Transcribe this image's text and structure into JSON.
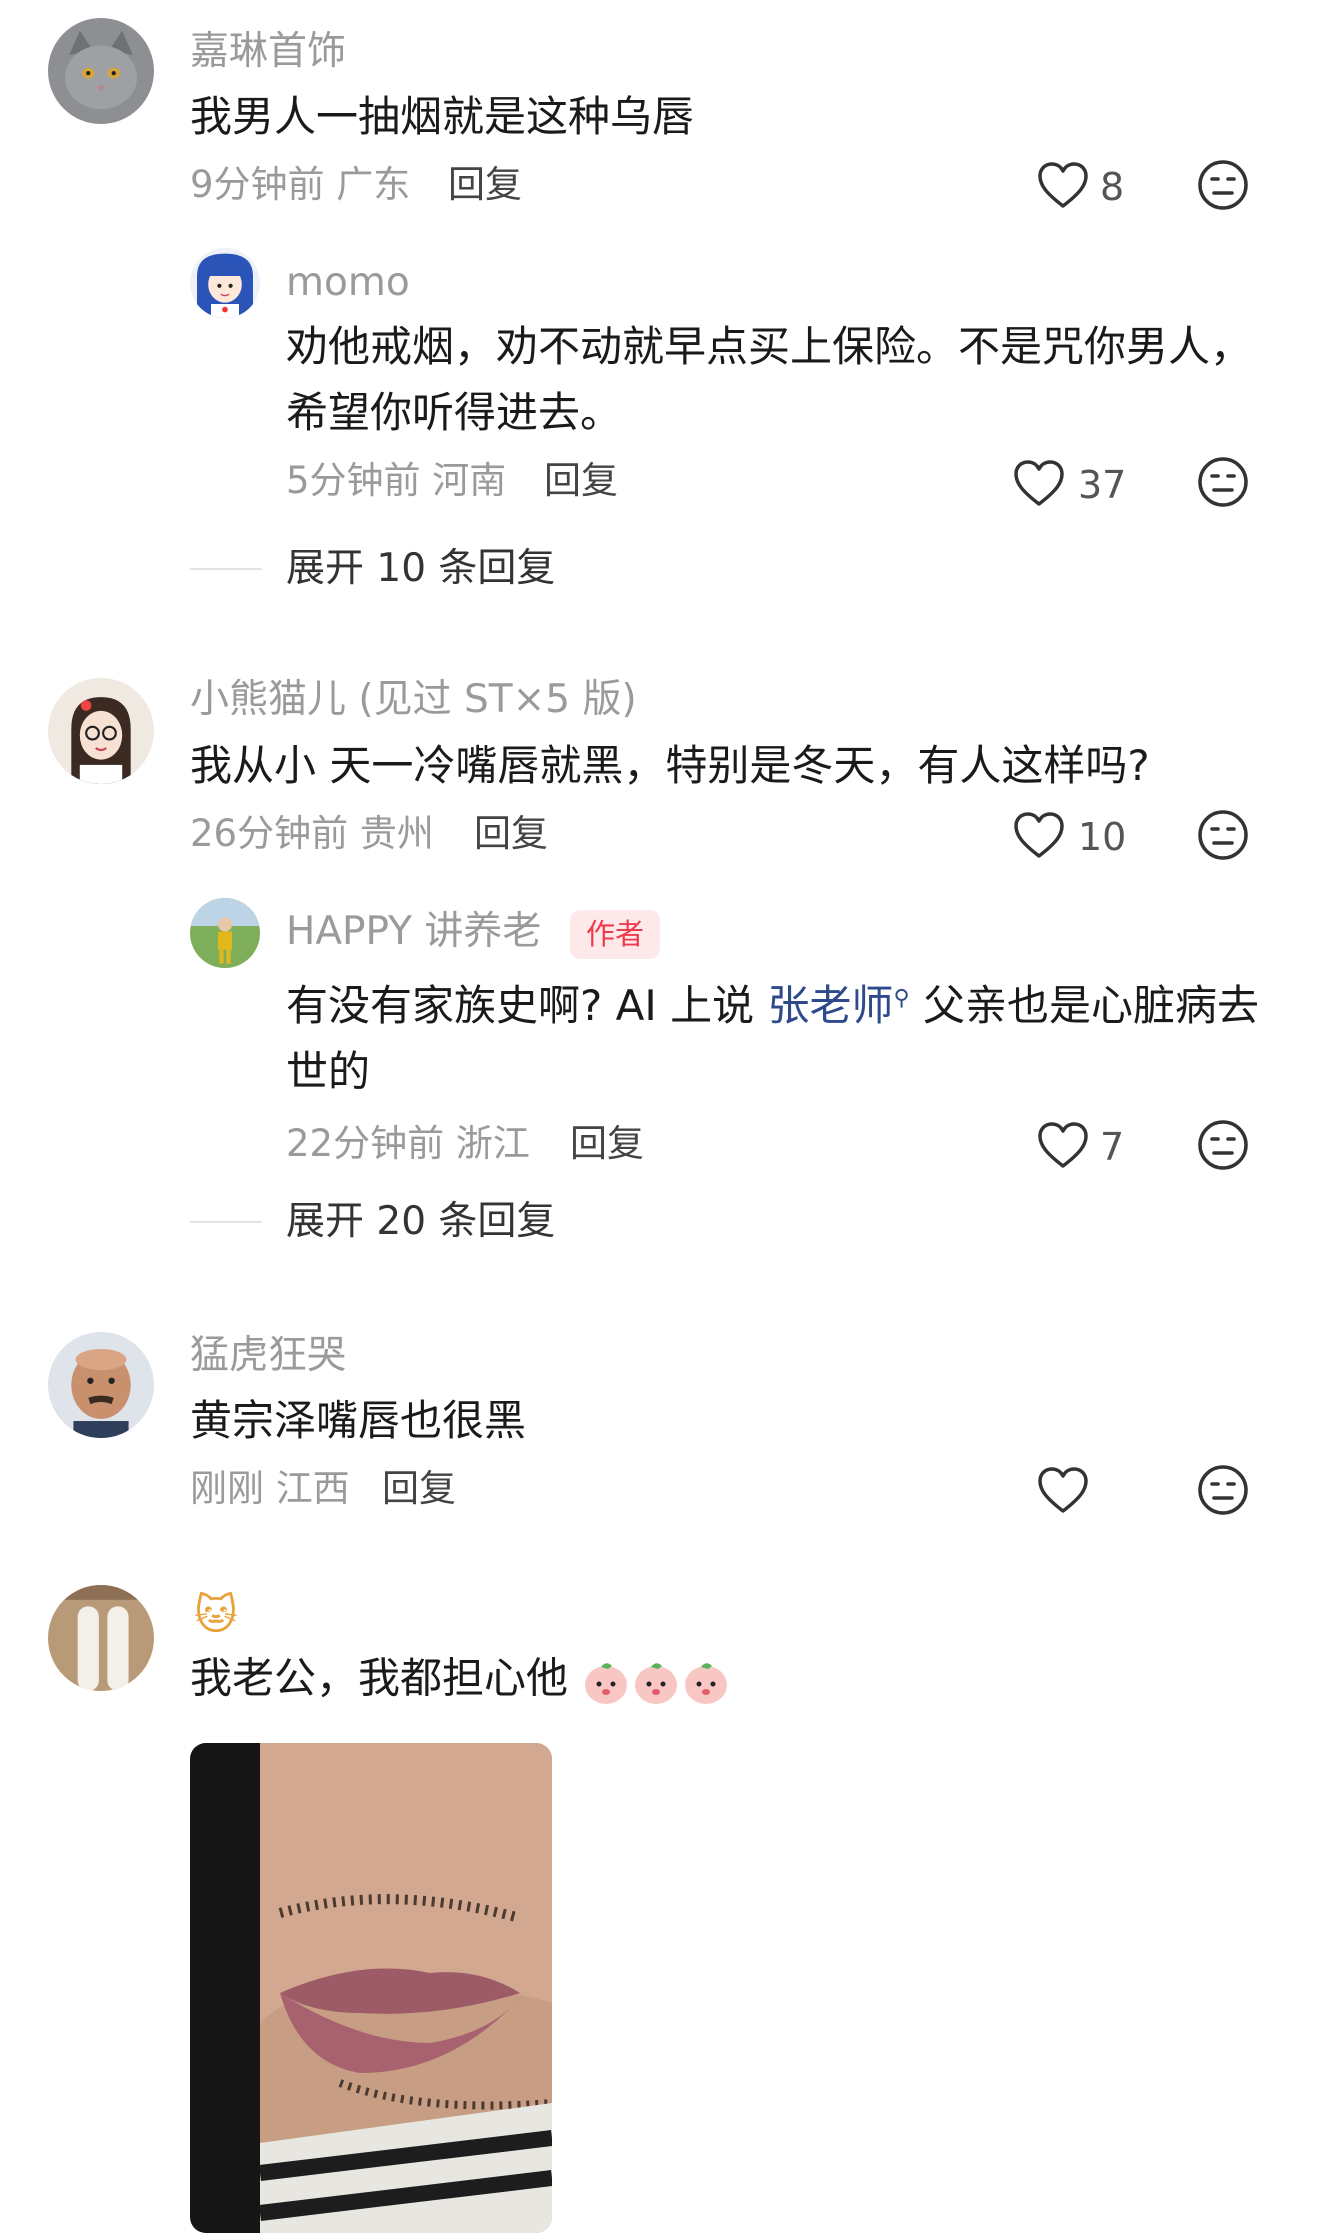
{
  "comments": [
    {
      "author": "嘉琳首饰",
      "text": "我男人一抽烟就是这种乌唇",
      "time_location": "9分钟前 广东",
      "reply_label": "回复",
      "likes": "8",
      "replies": [
        {
          "author": "momo",
          "text": "劝他戒烟，劝不动就早点买上保险。不是咒你男人，希望你听得进去。",
          "time_location": "5分钟前 河南",
          "reply_label": "回复",
          "likes": "37"
        }
      ],
      "expand_label": "展开 10 条回复"
    },
    {
      "author": "小熊猫儿 (见过 ST×5 版)",
      "text": "我从小 天一冷嘴唇就黑，特别是冬天，有人这样吗?",
      "time_location": "26分钟前 贵州",
      "reply_label": "回复",
      "likes": "10",
      "replies": [
        {
          "author": "HAPPY 讲养老",
          "badge": "作者",
          "text_before": "有没有家族史啊? AI 上说 ",
          "mention": "张老师",
          "text_after": " 父亲也是心脏病去世的",
          "time_location": "22分钟前 浙江",
          "reply_label": "回复",
          "likes": "7"
        }
      ],
      "expand_label": "展开 20 条回复"
    },
    {
      "author": "猛虎狂哭",
      "text": "黄宗泽嘴唇也很黑",
      "time_location": "刚刚 江西",
      "reply_label": "回复",
      "likes": ""
    },
    {
      "author_icon": "cat-face-emoji",
      "author_emoji": "🐱",
      "text": "我老公，我都担心他",
      "trailing_icons": [
        "peach-face-emoji",
        "peach-face-emoji",
        "peach-face-emoji"
      ]
    }
  ],
  "colors": {
    "meta_gray": "#9a9a9a",
    "author_badge_bg": "#fde9ea",
    "author_badge_text": "#f0394d",
    "mention_blue": "#2e4a8a"
  }
}
